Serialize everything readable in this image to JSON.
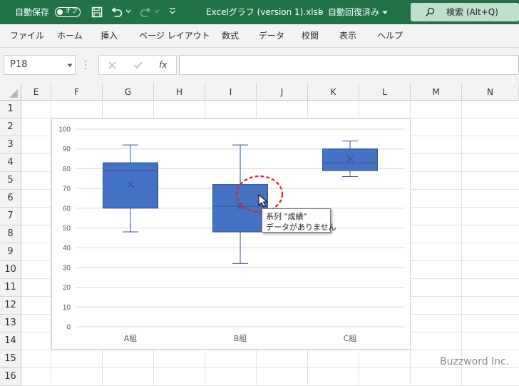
{
  "titlebar": {
    "autosave_label": "自動保存",
    "autosave_state": "オフ",
    "file_title": "Excelグラフ (version 1).xlsb",
    "separator": "-",
    "save_status": "自動回復済み",
    "search_label": "検索 (Alt+Q)",
    "accent_color": "#217346"
  },
  "menu": [
    "ファイル",
    "ホーム",
    "挿入",
    "ページ レイアウト",
    "数式",
    "データ",
    "校閲",
    "表示",
    "ヘルプ"
  ],
  "formula_bar": {
    "name_box": "P18",
    "fx_label": "fx",
    "value": ""
  },
  "columns": [
    "E",
    "F",
    "G",
    "H",
    "I",
    "J",
    "K",
    "L",
    "M",
    "N"
  ],
  "rows": [
    "1",
    "2",
    "3",
    "4",
    "5",
    "6",
    "7",
    "8",
    "9",
    "10",
    "11",
    "12",
    "13",
    "14",
    "15",
    "16"
  ],
  "chart_data": {
    "type": "boxplot",
    "categories": [
      "A組",
      "B組",
      "C組"
    ],
    "ylim": [
      0,
      100
    ],
    "yticks": [
      0,
      10,
      20,
      30,
      40,
      50,
      60,
      70,
      80,
      90,
      100
    ],
    "grid": true,
    "series_color": "#4472c4",
    "boxes": [
      {
        "category": "A組",
        "min": 48,
        "q1": 60,
        "median": 79,
        "mean": 72,
        "q3": 83,
        "max": 92
      },
      {
        "category": "B組",
        "min": 32,
        "q1": 48,
        "median": 61,
        "mean": 61,
        "q3": 72,
        "max": 92
      },
      {
        "category": "C組",
        "min": 76,
        "q1": 79,
        "median": 83,
        "mean": 85,
        "q3": 90,
        "max": 94
      }
    ]
  },
  "tooltip": {
    "line1": "系列 \"成績\"",
    "line2": "データがありません"
  },
  "watermark": "Buzzword Inc."
}
